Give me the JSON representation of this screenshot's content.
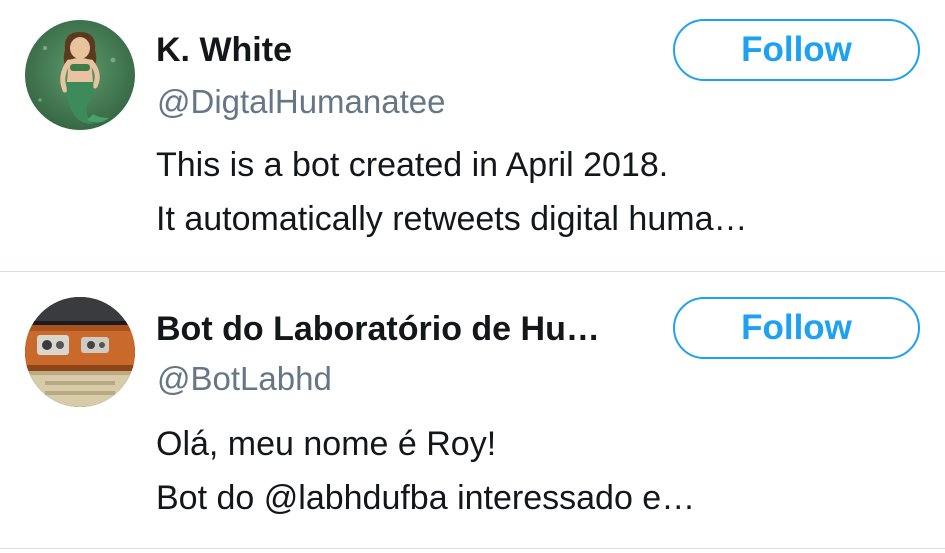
{
  "colors": {
    "accent": "#1da1f2",
    "text_primary": "#14171a",
    "text_secondary": "#657786",
    "divider": "#d6dde4"
  },
  "users": [
    {
      "name": "K. White",
      "handle": "@DigtalHumanatee",
      "bio_lines": [
        "This is a bot created in April 2018.",
        "It automatically retweets digital huma…"
      ],
      "follow_label": "Follow",
      "avatar_icon": "mermaid-avatar"
    },
    {
      "name": "Bot do Laboratório de Hu…",
      "handle": "@BotLabhd",
      "bio_lines": [
        "Olá, meu nome é Roy!",
        "Bot do @labhdufba interessado e…"
      ],
      "follow_label": "Follow",
      "avatar_icon": "robot-avatar"
    }
  ]
}
